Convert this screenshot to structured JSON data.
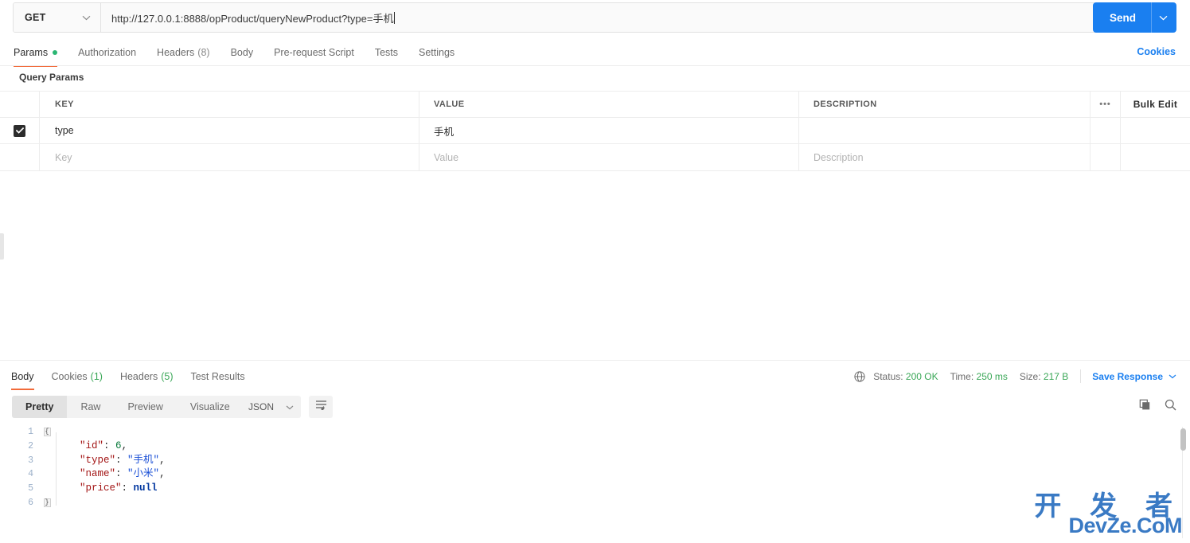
{
  "request": {
    "method": "GET",
    "url": "http://127.0.0.1:8888/opProduct/queryNewProduct?type=手机",
    "send_label": "Send",
    "cookies_link": "Cookies",
    "tabs": [
      {
        "label": "Params",
        "count": "",
        "active": true,
        "dot": true
      },
      {
        "label": "Authorization",
        "count": "",
        "active": false,
        "dot": false
      },
      {
        "label": "Headers",
        "count": "(8)",
        "active": false,
        "dot": false
      },
      {
        "label": "Body",
        "count": "",
        "active": false,
        "dot": false
      },
      {
        "label": "Pre-request Script",
        "count": "",
        "active": false,
        "dot": false
      },
      {
        "label": "Tests",
        "count": "",
        "active": false,
        "dot": false
      },
      {
        "label": "Settings",
        "count": "",
        "active": false,
        "dot": false
      }
    ]
  },
  "query_params": {
    "section_title": "Query Params",
    "columns": {
      "key": "KEY",
      "value": "VALUE",
      "description": "DESCRIPTION"
    },
    "bulk_edit_label": "Bulk Edit",
    "options_glyph": "•••",
    "rows": [
      {
        "checked": true,
        "key": "type",
        "value": "手机",
        "description": ""
      }
    ],
    "new_row": {
      "key_placeholder": "Key",
      "value_placeholder": "Value",
      "description_placeholder": "Description"
    }
  },
  "response": {
    "tabs": [
      {
        "label": "Body",
        "count": "",
        "active": true
      },
      {
        "label": "Cookies",
        "count": "(1)",
        "active": false
      },
      {
        "label": "Headers",
        "count": "(5)",
        "active": false
      },
      {
        "label": "Test Results",
        "count": "",
        "active": false
      }
    ],
    "status_label": "Status:",
    "status_value": "200 OK",
    "time_label": "Time:",
    "time_value": "250 ms",
    "size_label": "Size:",
    "size_value": "217 B",
    "save_response_label": "Save Response",
    "view_modes": [
      {
        "label": "Pretty",
        "active": true
      },
      {
        "label": "Raw",
        "active": false
      },
      {
        "label": "Preview",
        "active": false
      },
      {
        "label": "Visualize",
        "active": false
      }
    ],
    "language": "JSON",
    "icons": {
      "globe": "globe-icon",
      "wrap": "wrap-lines-icon",
      "copy": "copy-icon",
      "search": "search-icon"
    },
    "body_lines": [
      {
        "n": "1",
        "fold": "{",
        "segments": []
      },
      {
        "n": "2",
        "fold": "",
        "segments": [
          {
            "t": "    ",
            "c": "k-punc"
          },
          {
            "t": "\"id\"",
            "c": "k-key"
          },
          {
            "t": ": ",
            "c": "k-punc"
          },
          {
            "t": "6",
            "c": "k-num"
          },
          {
            "t": ",",
            "c": "k-punc"
          }
        ]
      },
      {
        "n": "3",
        "fold": "",
        "segments": [
          {
            "t": "    ",
            "c": "k-punc"
          },
          {
            "t": "\"type\"",
            "c": "k-key"
          },
          {
            "t": ": ",
            "c": "k-punc"
          },
          {
            "t": "\"手机\"",
            "c": "k-str"
          },
          {
            "t": ",",
            "c": "k-punc"
          }
        ]
      },
      {
        "n": "4",
        "fold": "",
        "segments": [
          {
            "t": "    ",
            "c": "k-punc"
          },
          {
            "t": "\"name\"",
            "c": "k-key"
          },
          {
            "t": ": ",
            "c": "k-punc"
          },
          {
            "t": "\"小米\"",
            "c": "k-str"
          },
          {
            "t": ",",
            "c": "k-punc"
          }
        ]
      },
      {
        "n": "5",
        "fold": "",
        "segments": [
          {
            "t": "    ",
            "c": "k-punc"
          },
          {
            "t": "\"price\"",
            "c": "k-key"
          },
          {
            "t": ": ",
            "c": "k-punc"
          },
          {
            "t": "null",
            "c": "k-null"
          }
        ]
      },
      {
        "n": "6",
        "fold": "}",
        "segments": []
      }
    ]
  },
  "watermark": {
    "cn": "开 发 者",
    "en": "DevZe.CoM"
  },
  "colors": {
    "accent_blue": "#1a7ff0",
    "tab_underline": "#f26b3a",
    "status_green": "#3aa757",
    "dot_green": "#2bb673"
  }
}
